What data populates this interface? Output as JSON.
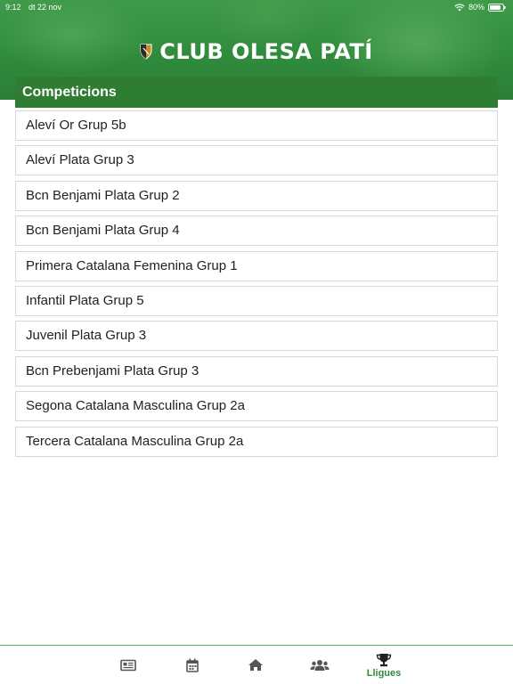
{
  "status_bar": {
    "time": "9:12",
    "date": "dt 22 nov",
    "battery": "80%"
  },
  "header": {
    "title": "CLUB OLESA PATÍ",
    "logo_icon": "club-shield-icon"
  },
  "section": {
    "title": "Competicions"
  },
  "competitions": [
    "Aleví Or Grup 5b",
    "Aleví Plata Grup 3",
    "Bcn Benjami Plata Grup 2",
    "Bcn Benjami Plata Grup 4",
    "Primera Catalana Femenina Grup 1",
    "Infantil Plata Grup 5",
    "Juvenil Plata Grup 3",
    "Bcn Prebenjami Plata Grup 3",
    "Segona Catalana Masculina Grup 2a",
    "Tercera Catalana Masculina Grup 2a"
  ],
  "tabbar": {
    "tabs": [
      {
        "icon": "news-icon",
        "label": ""
      },
      {
        "icon": "calendar-icon",
        "label": ""
      },
      {
        "icon": "home-icon",
        "label": ""
      },
      {
        "icon": "team-icon",
        "label": ""
      },
      {
        "icon": "trophy-icon",
        "label": "Lligues",
        "active": true
      }
    ]
  },
  "colors": {
    "brand_green": "#2f7d32",
    "active_tab": "#2e8b3a"
  }
}
